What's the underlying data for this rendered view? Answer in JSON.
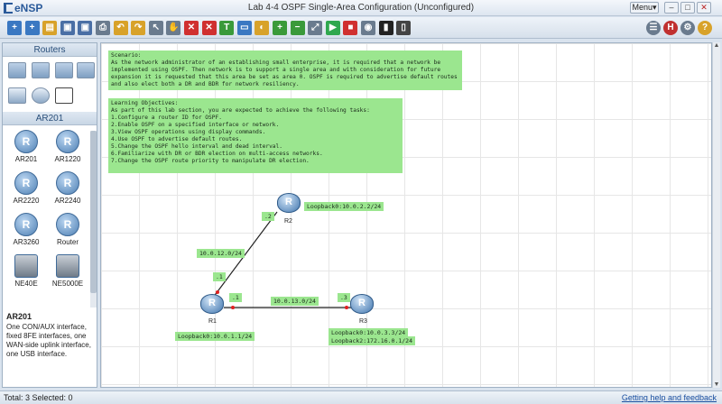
{
  "app": {
    "name": "eNSP",
    "window_title": "Lab 4-4 OSPF Single-Area Configuration (Unconfigured)",
    "menu_label": "Menu▾"
  },
  "window_controls": [
    "–",
    "□",
    "✕"
  ],
  "toolbar": {
    "icons": [
      "new-topology-icon",
      "new-lab-icon",
      "open-icon",
      "save-icon",
      "save-as-icon",
      "print-icon",
      "undo-icon",
      "redo-icon",
      "select-icon",
      "pan-icon",
      "delete-icon",
      "delete-link-icon",
      "text-icon",
      "rectangle-icon",
      "palette-icon",
      "zoom-in-icon",
      "zoom-out-icon",
      "fit-icon",
      "start-icon",
      "stop-icon",
      "capture-icon",
      "cli-icon",
      "topology-icon"
    ],
    "right_icons": [
      "chat-icon",
      "huawei-icon",
      "settings-icon",
      "help-icon"
    ]
  },
  "palette": {
    "routers_header": "Routers",
    "category_header": "AR201",
    "devices": [
      {
        "label": "AR201",
        "icon": "router-icon"
      },
      {
        "label": "AR1220",
        "icon": "router-icon"
      },
      {
        "label": "AR2220",
        "icon": "router-icon"
      },
      {
        "label": "AR2240",
        "icon": "router-icon"
      },
      {
        "label": "AR3260",
        "icon": "router-icon"
      },
      {
        "label": "Router",
        "icon": "router-icon"
      },
      {
        "label": "NE40E",
        "icon": "chassis-icon"
      },
      {
        "label": "NE5000E",
        "icon": "chassis-icon"
      }
    ],
    "description_title": "AR201",
    "description_text": "One CON/AUX interface, fixed 8FE interfaces, one WAN-side uplink interface, one USB interface."
  },
  "canvas": {
    "scenario": "Scenario:\nAs the network administrator of an establishing small enterprise, it is required that a network be\nimplemented using OSPF. Then network is to support a single area and with consideration for future\nexpansion it is requested that this area be set as area 0. OSPF is required to advertise default routes\nand also elect both a DR and BDR for network resiliency.",
    "objectives": "Learning Objectives:\nAs part of this lab section, you are expected to achieve the following tasks:\n1.Configure a router ID for OSPF.\n2.Enable OSPF on a specified interface or network.\n3.View OSPF operations using display commands.\n4.Use OSPF to advertise default routes.\n5.Change the OSPF hello interval and dead interval.\n6.Familiarize with DR or BDR election on multi-access networks.\n7.Change the OSPF route priority to manipulate DR election.",
    "routers": [
      {
        "name": "R1"
      },
      {
        "name": "R2"
      },
      {
        "name": "R3"
      }
    ],
    "labels": {
      "r2_loopback": "Loopback0:10.0.2.2/24",
      "r1_loopback": "Loopback0:10.0.1.1/24",
      "r3_loopback0": "Loopback0:10.0.3.3/24",
      "r3_loopback2": "Loopback2:172.16.0.1/24",
      "link_r1_r2": "10.0.12.0/24",
      "link_r1_r3": "10.0.13.0/24",
      "if_r2": ".2",
      "if_r1_up": ".1",
      "if_r1_right": ".1",
      "if_r3": ".3"
    }
  },
  "status": {
    "left": "Total: 3  Selected: 0",
    "help_link": "Getting help and feedback"
  }
}
